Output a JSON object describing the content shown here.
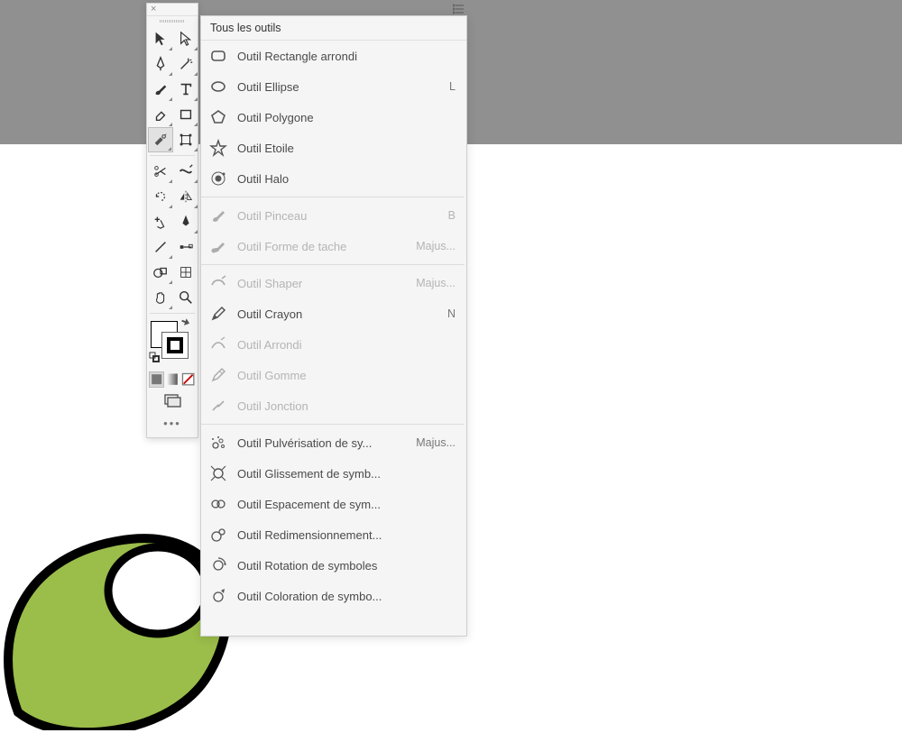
{
  "panel": {
    "title": "Tous les outils",
    "close_glyph": "×"
  },
  "toolbox": {
    "more_dots": "•••"
  },
  "tool_groups": [
    {
      "items": [
        {
          "id": "rounded-rect",
          "label": "Outil Rectangle arrondi",
          "shortcut": "",
          "disabled": false
        },
        {
          "id": "ellipse",
          "label": "Outil Ellipse",
          "shortcut": "L",
          "disabled": false
        },
        {
          "id": "polygon",
          "label": "Outil Polygone",
          "shortcut": "",
          "disabled": false
        },
        {
          "id": "star",
          "label": "Outil Etoile",
          "shortcut": "",
          "disabled": false
        },
        {
          "id": "flare",
          "label": "Outil Halo",
          "shortcut": "",
          "disabled": false
        }
      ]
    },
    {
      "items": [
        {
          "id": "brush",
          "label": "Outil Pinceau",
          "shortcut": "B",
          "disabled": true
        },
        {
          "id": "blob-brush",
          "label": "Outil Forme de tache",
          "shortcut": "Majus...",
          "disabled": true
        }
      ]
    },
    {
      "items": [
        {
          "id": "shaper",
          "label": "Outil Shaper",
          "shortcut": "Majus...",
          "disabled": true
        },
        {
          "id": "pencil",
          "label": "Outil Crayon",
          "shortcut": "N",
          "disabled": false
        },
        {
          "id": "smooth",
          "label": "Outil Arrondi",
          "shortcut": "",
          "disabled": true
        },
        {
          "id": "eraser",
          "label": "Outil Gomme",
          "shortcut": "",
          "disabled": true
        },
        {
          "id": "join",
          "label": "Outil Jonction",
          "shortcut": "",
          "disabled": true
        }
      ]
    },
    {
      "items": [
        {
          "id": "sym-spray",
          "label": "Outil Pulvérisation de sy...",
          "shortcut": "Majus...",
          "disabled": false
        },
        {
          "id": "sym-shift",
          "label": "Outil Glissement de symb...",
          "shortcut": "",
          "disabled": false
        },
        {
          "id": "sym-scrunch",
          "label": "Outil Espacement de sym...",
          "shortcut": "",
          "disabled": false
        },
        {
          "id": "sym-size",
          "label": "Outil Redimensionnement...",
          "shortcut": "",
          "disabled": false
        },
        {
          "id": "sym-spin",
          "label": "Outil Rotation de symboles",
          "shortcut": "",
          "disabled": false
        },
        {
          "id": "sym-stain",
          "label": "Outil Coloration de symbo...",
          "shortcut": "",
          "disabled": false
        }
      ]
    }
  ]
}
